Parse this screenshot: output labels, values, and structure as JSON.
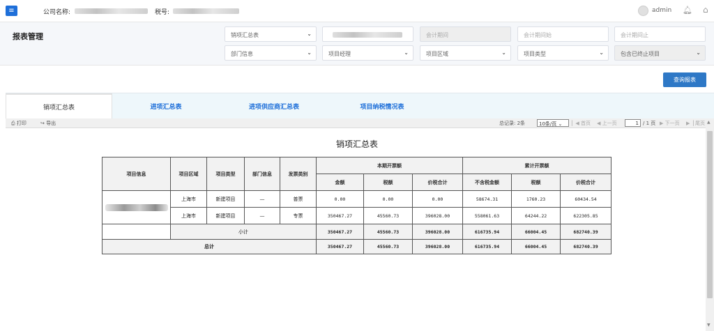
{
  "header": {
    "company_label": "公司名称:",
    "tax_label": "税号:",
    "user": "admin",
    "menu_icon": "menu-icon",
    "bell_icon": "bell-icon",
    "home_icon": "home-icon"
  },
  "page": {
    "title": "报表管理"
  },
  "filters": {
    "report_type": "销项汇总表",
    "period": "会计期间",
    "period_start": "会计期间始",
    "period_end": "会计期间止",
    "department": "部门信息",
    "project_manager": "项目经理",
    "project_region": "项目区域",
    "project_type": "项目类型",
    "include_terminated": "包含已终止项目"
  },
  "buttons": {
    "query": "查询报表"
  },
  "tabs": [
    {
      "label": "销项汇总表"
    },
    {
      "label": "进项汇总表"
    },
    {
      "label": "进项供应商汇总表"
    },
    {
      "label": "项目纳税情况表"
    }
  ],
  "toolbar": {
    "print": "打印",
    "export": "导出",
    "total_records": "总记录: 2条",
    "page_size": "10条/页",
    "first": "首页",
    "prev": "上一页",
    "page_input": "1",
    "page_total": "/ 1 页",
    "next": "下一页",
    "last": "尾页"
  },
  "report": {
    "title": "销项汇总表",
    "headers": {
      "project_info": "项目信息",
      "region": "项目区域",
      "type": "项目类型",
      "dept": "部门信息",
      "invoice_type": "发票类别",
      "current_group": "本期开票额",
      "cumulative_group": "累计开票额",
      "amount": "金额",
      "tax": "税额",
      "total_with_tax": "价税合计",
      "amount_ex_tax": "不含税金额",
      "tax2": "税额",
      "total_with_tax2": "价税合计"
    },
    "rows": [
      {
        "region": "上海市",
        "type": "新建项目",
        "dept": "—",
        "invoice_type": "普票",
        "amount": "0.00",
        "tax": "0.00",
        "total": "0.00",
        "cum_amount": "58674.31",
        "cum_tax": "1760.23",
        "cum_total": "60434.54"
      },
      {
        "region": "上海市",
        "type": "新建项目",
        "dept": "—",
        "invoice_type": "专票",
        "amount": "350467.27",
        "tax": "45560.73",
        "total": "396028.00",
        "cum_amount": "558061.63",
        "cum_tax": "64244.22",
        "cum_total": "622305.85"
      }
    ],
    "subtotal": {
      "label": "小计",
      "amount": "350467.27",
      "tax": "45560.73",
      "total": "396028.00",
      "cum_amount": "616735.94",
      "cum_tax": "66004.45",
      "cum_total": "682740.39"
    },
    "grand_total": {
      "label": "总计",
      "amount": "350467.27",
      "tax": "45560.73",
      "total": "396028.00",
      "cum_amount": "616735.94",
      "cum_tax": "66004.45",
      "cum_total": "682740.39"
    }
  },
  "colors": {
    "primary": "#2e78c6",
    "tab_link": "#1e6fd9"
  }
}
